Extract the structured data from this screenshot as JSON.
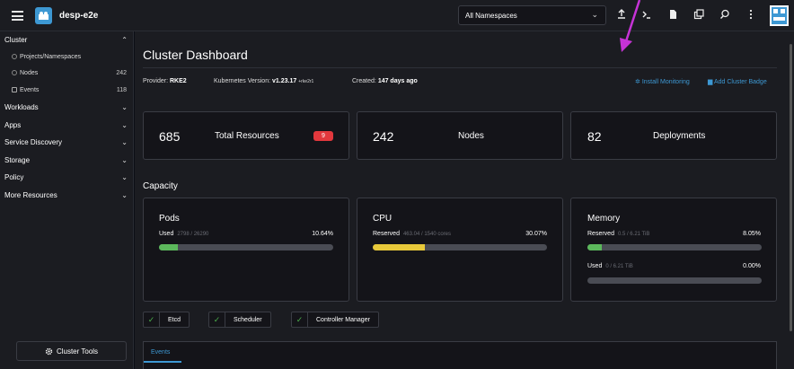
{
  "topbar": {
    "cluster_name": "desp-e2e",
    "namespace_select": "All Namespaces"
  },
  "sidebar": {
    "cluster_group": "Cluster",
    "items": [
      {
        "label": "Projects/Namespaces",
        "count": ""
      },
      {
        "label": "Nodes",
        "count": "242"
      },
      {
        "label": "Events",
        "count": "118"
      }
    ],
    "groups": [
      "Workloads",
      "Apps",
      "Service Discovery",
      "Storage",
      "Policy",
      "More Resources"
    ],
    "cluster_tools": "Cluster Tools"
  },
  "page": {
    "title": "Cluster Dashboard",
    "provider_label": "Provider:",
    "provider_value": "RKE2",
    "k8s_label": "Kubernetes Version:",
    "k8s_value": "v1.23.17",
    "k8s_suffix": "+rke2r1",
    "created_label": "Created:",
    "created_value": "147 days ago",
    "install_monitoring": "Install Monitoring",
    "add_cluster_badge": "Add Cluster Badge"
  },
  "stats": [
    {
      "value": "685",
      "label": "Total Resources",
      "badge": "9"
    },
    {
      "value": "242",
      "label": "Nodes"
    },
    {
      "value": "82",
      "label": "Deployments"
    }
  ],
  "capacity": {
    "title": "Capacity",
    "pods": {
      "title": "Pods",
      "label": "Used",
      "detail": "2798 / 26290",
      "pct": "10.64%",
      "fraction": 0.1064
    },
    "cpu": {
      "title": "CPU",
      "label": "Reserved",
      "detail": "463.04 / 1540 cores",
      "pct": "30.07%",
      "fraction": 0.3007
    },
    "memory": {
      "title": "Memory",
      "reserved": {
        "label": "Reserved",
        "detail": "0.5 / 6.21 TiB",
        "pct": "8.05%",
        "fraction": 0.0805
      },
      "used": {
        "label": "Used",
        "detail": "0 / 6.21 TiB",
        "pct": "0.00%",
        "fraction": 0.0
      }
    }
  },
  "components": [
    "Etcd",
    "Scheduler",
    "Controller Manager"
  ],
  "events_tab": "Events",
  "colors": {
    "accent": "#3d98d3",
    "annotation_arrow": "#c633d6",
    "badge": "#e2383d",
    "ok": "#4cae4c",
    "pods_bar": "#5cb85c",
    "cpu_bar": "#e8c93a"
  }
}
